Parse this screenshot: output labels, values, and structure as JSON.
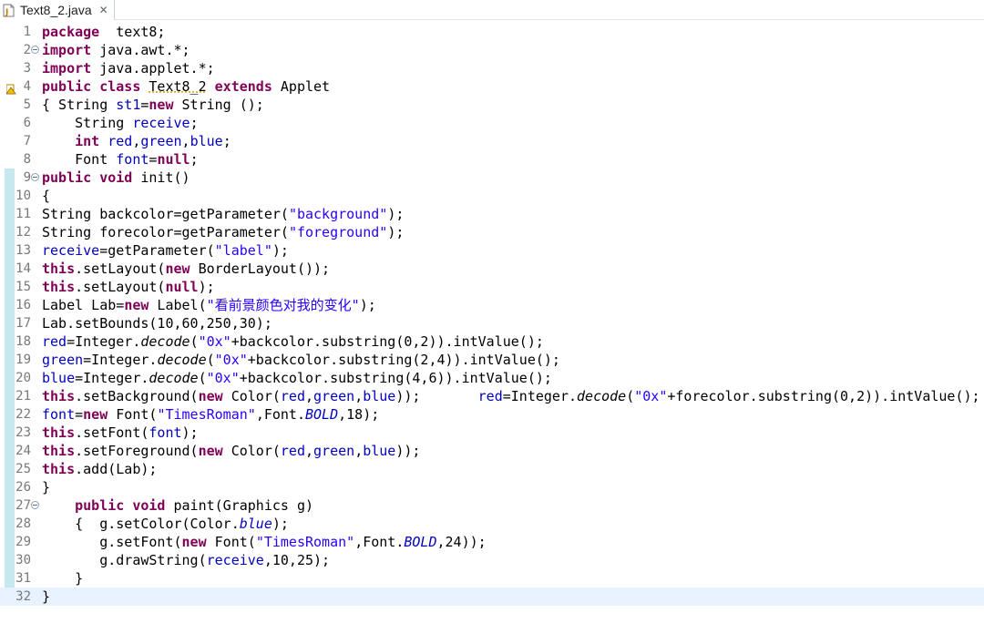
{
  "tab": {
    "title": "Text8_2.java",
    "icon": "java-file-icon",
    "close_icon": "close-icon"
  },
  "lines": [
    {
      "n": "1",
      "tokens": [
        [
          "kw",
          "package"
        ],
        [
          "",
          "  text8;"
        ]
      ]
    },
    {
      "n": "2",
      "fold": true,
      "tokens": [
        [
          "kw",
          "import"
        ],
        [
          "",
          " java.awt.*;"
        ]
      ]
    },
    {
      "n": "3",
      "tokens": [
        [
          "kw",
          "import"
        ],
        [
          "",
          " java.applet.*;"
        ]
      ]
    },
    {
      "n": "4",
      "warn": true,
      "tokens": [
        [
          "kw",
          "public"
        ],
        [
          "",
          " "
        ],
        [
          "kw",
          "class"
        ],
        [
          "",
          " "
        ],
        [
          "warn",
          "Text8_2"
        ],
        [
          "",
          " "
        ],
        [
          "kw",
          "extends"
        ],
        [
          "",
          " Applet"
        ]
      ]
    },
    {
      "n": "5",
      "tokens": [
        [
          "",
          "{ String "
        ],
        [
          "fld",
          "st1"
        ],
        [
          "",
          "="
        ],
        [
          "kw",
          "new"
        ],
        [
          "",
          " String ();"
        ]
      ]
    },
    {
      "n": "6",
      "tokens": [
        [
          "",
          "    String "
        ],
        [
          "fld",
          "receive"
        ],
        [
          "",
          ";"
        ]
      ]
    },
    {
      "n": "7",
      "tokens": [
        [
          "",
          "    "
        ],
        [
          "kw",
          "int"
        ],
        [
          "",
          " "
        ],
        [
          "fld",
          "red"
        ],
        [
          "",
          ","
        ],
        [
          "fld",
          "green"
        ],
        [
          "",
          ","
        ],
        [
          "fld",
          "blue"
        ],
        [
          "",
          ";"
        ]
      ]
    },
    {
      "n": "8",
      "tokens": [
        [
          "",
          "    Font "
        ],
        [
          "fld",
          "font"
        ],
        [
          "",
          "="
        ],
        [
          "kw",
          "null"
        ],
        [
          "",
          ";"
        ]
      ]
    },
    {
      "n": "9",
      "fold": true,
      "tokens": [
        [
          "kw",
          "public"
        ],
        [
          "",
          " "
        ],
        [
          "kw",
          "void"
        ],
        [
          "",
          " init()"
        ]
      ]
    },
    {
      "n": "10",
      "tokens": [
        [
          "",
          "{"
        ]
      ]
    },
    {
      "n": "11",
      "tokens": [
        [
          "",
          "String backcolor=getParameter("
        ],
        [
          "str",
          "\"background\""
        ],
        [
          "",
          ");"
        ]
      ]
    },
    {
      "n": "12",
      "tokens": [
        [
          "",
          "String forecolor=getParameter("
        ],
        [
          "str",
          "\"foreground\""
        ],
        [
          "",
          ");"
        ]
      ]
    },
    {
      "n": "13",
      "tokens": [
        [
          "fld",
          "receive"
        ],
        [
          "",
          "=getParameter("
        ],
        [
          "str",
          "\"label\""
        ],
        [
          "",
          ");"
        ]
      ]
    },
    {
      "n": "14",
      "tokens": [
        [
          "kw",
          "this"
        ],
        [
          "",
          ".setLayout("
        ],
        [
          "kw",
          "new"
        ],
        [
          "",
          " BorderLayout());"
        ]
      ]
    },
    {
      "n": "15",
      "tokens": [
        [
          "kw",
          "this"
        ],
        [
          "",
          ".setLayout("
        ],
        [
          "kw",
          "null"
        ],
        [
          "",
          ");"
        ]
      ]
    },
    {
      "n": "16",
      "tokens": [
        [
          "",
          "Label Lab="
        ],
        [
          "kw",
          "new"
        ],
        [
          "",
          " Label("
        ],
        [
          "str",
          "\"看前景颜色对我的变化\""
        ],
        [
          "",
          ");"
        ]
      ]
    },
    {
      "n": "17",
      "tokens": [
        [
          "",
          "Lab.setBounds(10,60,250,30);"
        ]
      ]
    },
    {
      "n": "18",
      "tokens": [
        [
          "fld",
          "red"
        ],
        [
          "",
          "=Integer."
        ],
        [
          "ital",
          "decode"
        ],
        [
          "",
          "("
        ],
        [
          "str",
          "\"0x\""
        ],
        [
          "",
          "+backcolor.substring(0,2)).intValue();"
        ]
      ]
    },
    {
      "n": "19",
      "tokens": [
        [
          "fld",
          "green"
        ],
        [
          "",
          "=Integer."
        ],
        [
          "ital",
          "decode"
        ],
        [
          "",
          "("
        ],
        [
          "str",
          "\"0x\""
        ],
        [
          "",
          "+backcolor.substring(2,4)).intValue();"
        ]
      ]
    },
    {
      "n": "20",
      "tokens": [
        [
          "fld",
          "blue"
        ],
        [
          "",
          "=Integer."
        ],
        [
          "ital",
          "decode"
        ],
        [
          "",
          "("
        ],
        [
          "str",
          "\"0x\""
        ],
        [
          "",
          "+backcolor.substring(4,6)).intValue();"
        ]
      ]
    },
    {
      "n": "21",
      "tokens": [
        [
          "kw",
          "this"
        ],
        [
          "",
          ".setBackground("
        ],
        [
          "kw",
          "new"
        ],
        [
          "",
          " Color("
        ],
        [
          "fld",
          "red"
        ],
        [
          "",
          ","
        ],
        [
          "fld",
          "green"
        ],
        [
          "",
          ","
        ],
        [
          "fld",
          "blue"
        ],
        [
          "",
          "));       "
        ],
        [
          "fld",
          "red"
        ],
        [
          "",
          "=Integer."
        ],
        [
          "ital",
          "decode"
        ],
        [
          "",
          "("
        ],
        [
          "str",
          "\"0x\""
        ],
        [
          "",
          "+forecolor.substring(0,2)).intValue();"
        ]
      ]
    },
    {
      "n": "22",
      "tokens": [
        [
          "fld",
          "font"
        ],
        [
          "",
          "="
        ],
        [
          "kw",
          "new"
        ],
        [
          "",
          " Font("
        ],
        [
          "str",
          "\"TimesRoman\""
        ],
        [
          "",
          ",Font."
        ],
        [
          "italfld",
          "BOLD"
        ],
        [
          "",
          ",18);"
        ]
      ]
    },
    {
      "n": "23",
      "tokens": [
        [
          "kw",
          "this"
        ],
        [
          "",
          ".setFont("
        ],
        [
          "fld",
          "font"
        ],
        [
          "",
          ");"
        ]
      ]
    },
    {
      "n": "24",
      "tokens": [
        [
          "kw",
          "this"
        ],
        [
          "",
          ".setForeground("
        ],
        [
          "kw",
          "new"
        ],
        [
          "",
          " Color("
        ],
        [
          "fld",
          "red"
        ],
        [
          "",
          ","
        ],
        [
          "fld",
          "green"
        ],
        [
          "",
          ","
        ],
        [
          "fld",
          "blue"
        ],
        [
          "",
          "));"
        ]
      ]
    },
    {
      "n": "25",
      "tokens": [
        [
          "kw",
          "this"
        ],
        [
          "",
          ".add(Lab);"
        ]
      ]
    },
    {
      "n": "26",
      "tokens": [
        [
          "",
          "}"
        ]
      ]
    },
    {
      "n": "27",
      "fold": true,
      "tokens": [
        [
          "",
          "    "
        ],
        [
          "kw",
          "public"
        ],
        [
          "",
          " "
        ],
        [
          "kw",
          "void"
        ],
        [
          "",
          " paint(Graphics g)"
        ]
      ]
    },
    {
      "n": "28",
      "tokens": [
        [
          "",
          "    {  g.setColor(Color."
        ],
        [
          "italfld",
          "blue"
        ],
        [
          "",
          ");"
        ]
      ]
    },
    {
      "n": "29",
      "tokens": [
        [
          "",
          "       g.setFont("
        ],
        [
          "kw",
          "new"
        ],
        [
          "",
          " Font("
        ],
        [
          "str",
          "\"TimesRoman\""
        ],
        [
          "",
          ",Font."
        ],
        [
          "italfld",
          "BOLD"
        ],
        [
          "",
          ",24));"
        ]
      ]
    },
    {
      "n": "30",
      "tokens": [
        [
          "",
          "       g.drawString("
        ],
        [
          "fld",
          "receive"
        ],
        [
          "",
          ",10,25);"
        ]
      ]
    },
    {
      "n": "31",
      "tokens": [
        [
          "",
          "    }"
        ]
      ]
    },
    {
      "n": "32",
      "current": true,
      "tokens": [
        [
          "",
          "}"
        ]
      ]
    }
  ],
  "colors": {
    "keyword": "#7f0055",
    "field": "#0000c0",
    "string": "#2a00ff",
    "line_number": "#787878",
    "current_line": "#e8f2fe",
    "ruler_highlight": "#c7e8ee"
  }
}
